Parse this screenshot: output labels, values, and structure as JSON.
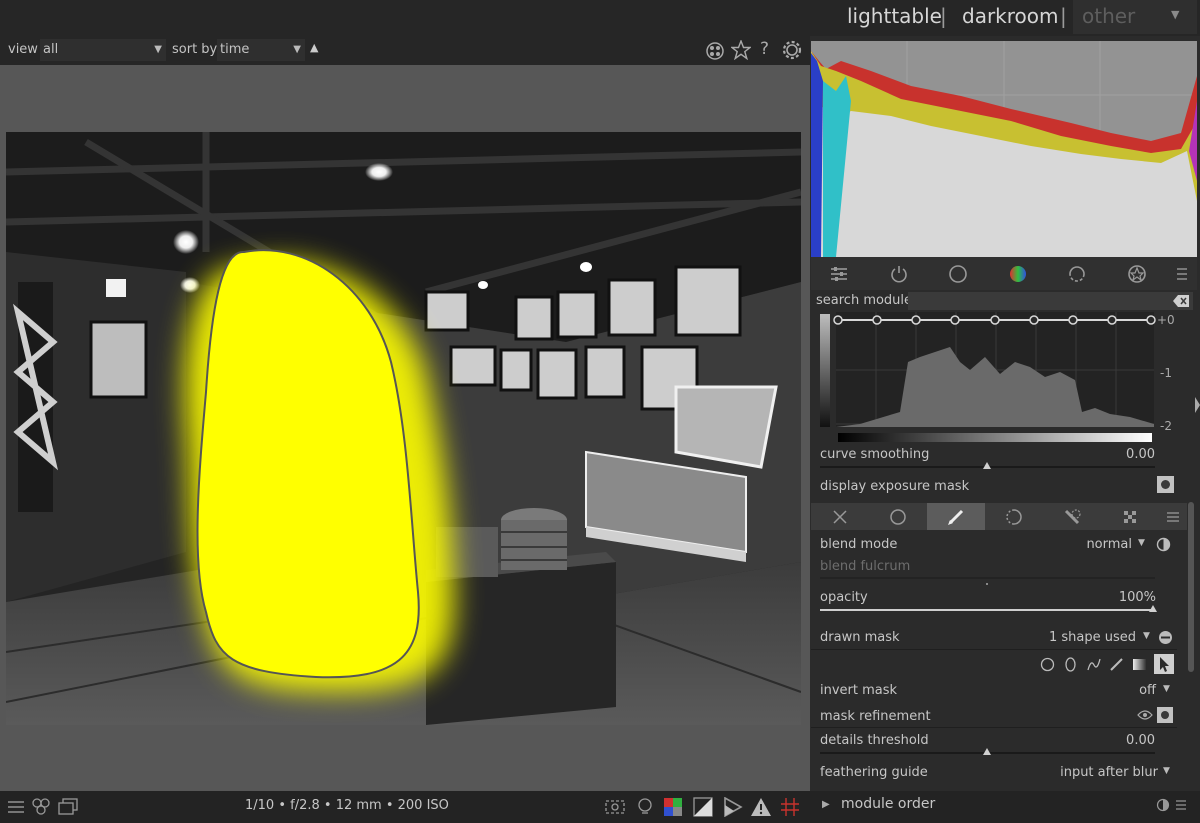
{
  "header": {
    "views": [
      "lighttable",
      "darkroom",
      "other"
    ],
    "separators": [
      "|",
      "|"
    ],
    "other_caret": "▼"
  },
  "filterbar": {
    "view_label": "view",
    "view_value": "all",
    "sort_label": "sort by",
    "sort_value": "time",
    "sort_dir": "▲",
    "icons": [
      "color-labels-icon",
      "star-icon",
      "help-icon",
      "gear-icon"
    ],
    "help_glyph": "?"
  },
  "search": {
    "label": "search module",
    "value": ""
  },
  "tone_curve": {
    "ev_labels": [
      "+0",
      "-1",
      "-2"
    ],
    "nodes": 9,
    "curve_smoothing_label": "curve smoothing",
    "curve_smoothing_value": "0.00",
    "display_exposure_mask_label": "display exposure mask"
  },
  "blending": {
    "blend_mode_label": "blend mode",
    "blend_mode_value": "normal",
    "blend_fulcrum_label": "blend fulcrum",
    "opacity_label": "opacity",
    "opacity_value": "100%",
    "drawn_mask_label": "drawn mask",
    "drawn_mask_value": "1 shape used",
    "invert_mask_label": "invert mask",
    "invert_mask_value": "off",
    "mask_refinement_label": "mask refinement",
    "details_threshold_label": "details threshold",
    "details_threshold_value": "0.00",
    "feathering_guide_label": "feathering guide",
    "feathering_guide_value": "input after blur",
    "caret": "▼"
  },
  "bottom": {
    "exif": "1/10 • f/2.8 • 12 mm • 200 ISO",
    "module_order_label": "module order",
    "module_order_arrow": "▶"
  },
  "colors": {
    "mask_yellow": "#ffff00",
    "hist_red": "#c8322d",
    "hist_yellow": "#c8c031",
    "hist_blue": "#2a3fc8",
    "hist_cyan": "#30c0c8"
  }
}
